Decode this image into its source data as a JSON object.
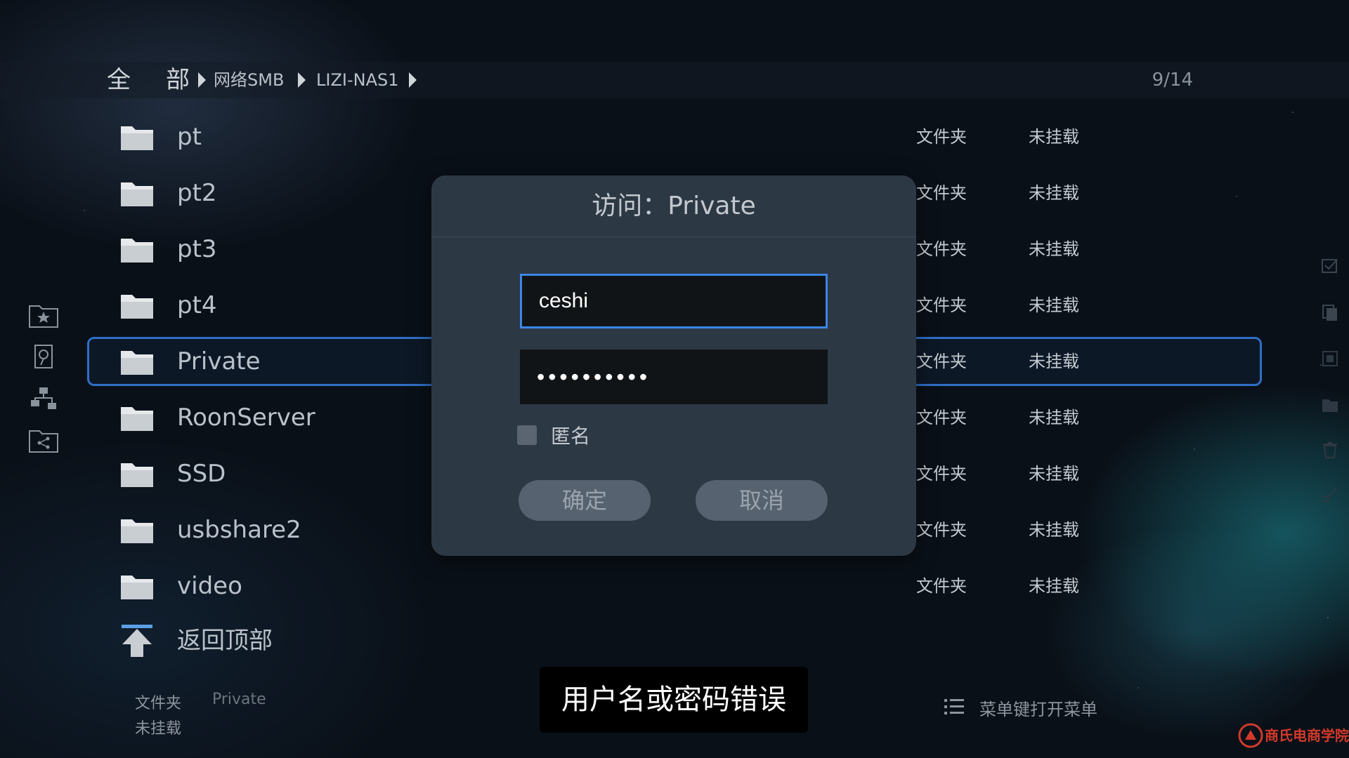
{
  "breadcrumb": {
    "root": [
      "全",
      "部"
    ],
    "items": [
      "网络SMB",
      "LIZI-NAS1"
    ],
    "page_count": "9/14"
  },
  "files": [
    {
      "name": "pt",
      "type": "文件夹",
      "mount": "未挂载"
    },
    {
      "name": "pt2",
      "type": "文件夹",
      "mount": "未挂载"
    },
    {
      "name": "pt3",
      "type": "文件夹",
      "mount": "未挂载"
    },
    {
      "name": "pt4",
      "type": "文件夹",
      "mount": "未挂载"
    },
    {
      "name": "Private",
      "type": "文件夹",
      "mount": "未挂载",
      "selected": true
    },
    {
      "name": "RoonServer",
      "type": "文件夹",
      "mount": "未挂载"
    },
    {
      "name": "SSD",
      "type": "文件夹",
      "mount": "未挂载"
    },
    {
      "name": "usbshare2",
      "type": "文件夹",
      "mount": "未挂载"
    },
    {
      "name": "video",
      "type": "文件夹",
      "mount": "未挂载"
    }
  ],
  "back_to_top": "返回顶部",
  "footer": {
    "info_type": "文件夹",
    "info_name": "Private",
    "info_mount": "未挂载",
    "menu_hint": "菜单键打开菜单"
  },
  "dialog": {
    "title": "访问：Private",
    "username": "ceshi",
    "password_mask": "••••••••••",
    "anonymous_label": "匿名",
    "anonymous_checked": false,
    "confirm_label": "确定",
    "cancel_label": "取消"
  },
  "toast": "用户名或密码错误",
  "watermark": "商氏电商学院",
  "colors": {
    "accent": "#3b86e8",
    "selection_border": "#2f6fc6",
    "dialog_bg": "#2d3845",
    "watermark": "#d23a2a"
  }
}
